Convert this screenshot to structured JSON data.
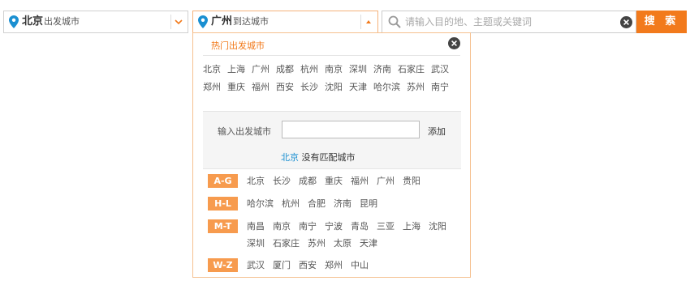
{
  "departure": {
    "city": "北京",
    "suffix": "出发城市"
  },
  "arrival": {
    "city": "广州",
    "suffix": "到达城市"
  },
  "search": {
    "placeholder": "请输入目的地、主题或关键词",
    "button_label": "搜 索"
  },
  "dropdown": {
    "hot_title": "热门出发城市",
    "hot_cities": [
      "北京",
      "上海",
      "广州",
      "成都",
      "杭州",
      "南京",
      "深圳",
      "济南",
      "石家庄",
      "武汉",
      "郑州",
      "重庆",
      "福州",
      "西安",
      "长沙",
      "沈阳",
      "天津",
      "哈尔滨",
      "苏州",
      "南宁"
    ],
    "input_label": "输入出发城市",
    "input_value": "",
    "add_label": "添加",
    "no_match_city": "北京",
    "no_match_text": "没有匹配城市",
    "groups": [
      {
        "label": "A-G",
        "cities": [
          "北京",
          "长沙",
          "成都",
          "重庆",
          "福州",
          "广州",
          "贵阳"
        ]
      },
      {
        "label": "H-L",
        "cities": [
          "哈尔滨",
          "杭州",
          "合肥",
          "济南",
          "昆明"
        ]
      },
      {
        "label": "M-T",
        "cities": [
          "南昌",
          "南京",
          "南宁",
          "宁波",
          "青岛",
          "三亚",
          "上海",
          "沈阳",
          "深圳",
          "石家庄",
          "苏州",
          "太原",
          "天津"
        ]
      },
      {
        "label": "W-Z",
        "cities": [
          "武汉",
          "厦门",
          "西安",
          "郑州",
          "中山"
        ]
      }
    ]
  },
  "colors": {
    "accent": "#f27a1c",
    "badge": "#f79b4e",
    "pin": "#1a8fd1",
    "link": "#1a8fd1"
  }
}
